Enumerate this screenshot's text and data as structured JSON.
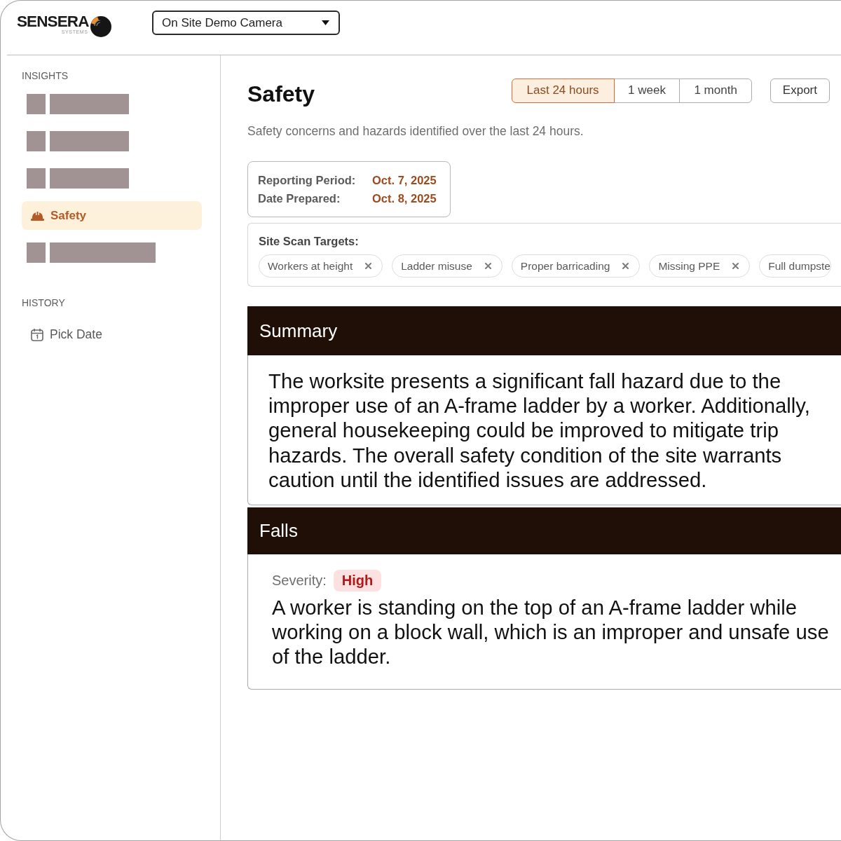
{
  "header": {
    "logo": {
      "name": "SENSERA",
      "tagline": "SYSTEMS"
    },
    "camera_select": {
      "value": "On Site Demo Camera"
    }
  },
  "sidebar": {
    "insights": {
      "title": "INSIGHTS",
      "items": [
        {
          "kind": "redacted",
          "wide": false,
          "selected": false
        },
        {
          "kind": "redacted",
          "wide": false,
          "selected": false
        },
        {
          "kind": "redacted",
          "wide": false,
          "selected": false
        },
        {
          "kind": "link",
          "label": "Safety",
          "selected": true
        },
        {
          "kind": "redacted",
          "wide": true,
          "selected": false
        }
      ]
    },
    "history": {
      "title": "HISTORY",
      "button": "Pick Date"
    }
  },
  "main": {
    "title": "Safety",
    "range_tabs": [
      {
        "label": "Last 24 hours",
        "selected": true
      },
      {
        "label": "1 week",
        "selected": false
      },
      {
        "label": "1 month",
        "selected": false
      }
    ],
    "export_button": "Export",
    "subtitle": "Safety concerns and hazards identified over the last 24 hours.",
    "report_info": [
      {
        "label": "Reporting Period:",
        "value": "Oct. 7, 2025"
      },
      {
        "label": "Date Prepared:",
        "value": "Oct. 8, 2025"
      }
    ],
    "scan_targets": {
      "title": "Site Scan Targets:",
      "chips": [
        {
          "label": "Workers at height",
          "removable": true
        },
        {
          "label": "Ladder misuse",
          "removable": true
        },
        {
          "label": "Proper barricading",
          "removable": true
        },
        {
          "label": "Missing PPE",
          "removable": true
        },
        {
          "label": "Full dumpste",
          "removable": false
        }
      ]
    },
    "sections": [
      {
        "kind": "summary",
        "title": "Summary",
        "text": "The worksite presents a significant fall hazard due to the improper use of an A-frame ladder by a worker. Additionally, general housekeeping could be improved to mitigate trip hazards. The overall safety condition of the site warrants caution until the identified issues are addressed."
      },
      {
        "kind": "finding",
        "title": "Falls",
        "severity": {
          "label": "Severity:",
          "value": "High"
        },
        "text": "A worker is standing on the top of an A-frame ladder while working on a block wall, which is an improper and unsafe use of the ladder."
      }
    ]
  }
}
